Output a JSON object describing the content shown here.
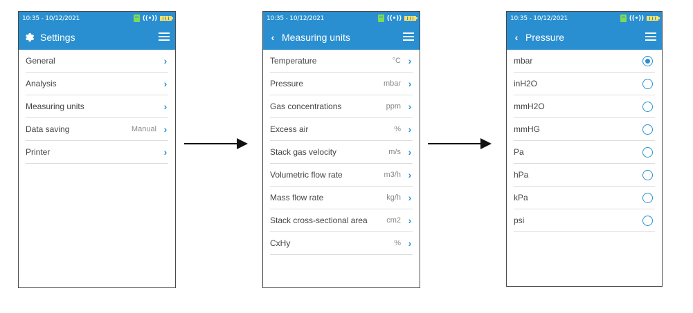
{
  "status_bar": {
    "time": "10:35 - 10/12/2021"
  },
  "screen1": {
    "title": "Settings",
    "items": [
      {
        "label": "General",
        "value": ""
      },
      {
        "label": "Analysis",
        "value": ""
      },
      {
        "label": "Measuring units",
        "value": ""
      },
      {
        "label": "Data saving",
        "value": "Manual"
      },
      {
        "label": "Printer",
        "value": ""
      }
    ]
  },
  "screen2": {
    "title": "Measuring units",
    "items": [
      {
        "label": "Temperature",
        "value": "°C"
      },
      {
        "label": "Pressure",
        "value": "mbar"
      },
      {
        "label": "Gas concentrations",
        "value": "ppm"
      },
      {
        "label": "Excess air",
        "value": "%"
      },
      {
        "label": "Stack gas velocity",
        "value": "m/s"
      },
      {
        "label": "Volumetric flow rate",
        "value": "m3/h"
      },
      {
        "label": "Mass flow rate",
        "value": "kg/h"
      },
      {
        "label": "Stack cross-sectional area",
        "value": "cm2"
      },
      {
        "label": "CxHy",
        "value": "%"
      }
    ]
  },
  "screen3": {
    "title": "Pressure",
    "selected": "mbar",
    "options": [
      "mbar",
      "inH2O",
      "mmH2O",
      "mmHG",
      "Pa",
      "hPa",
      "kPa",
      "psi"
    ]
  },
  "colors": {
    "header": "#2a8fd0",
    "accent": "#2a8fd0",
    "usb": "#7ed957",
    "battery": "#ffe066"
  },
  "icons": {
    "settings": "gear-icon",
    "back": "chevron-left-icon",
    "menu": "hamburger-menu-icon",
    "next": "chevron-right-icon"
  }
}
